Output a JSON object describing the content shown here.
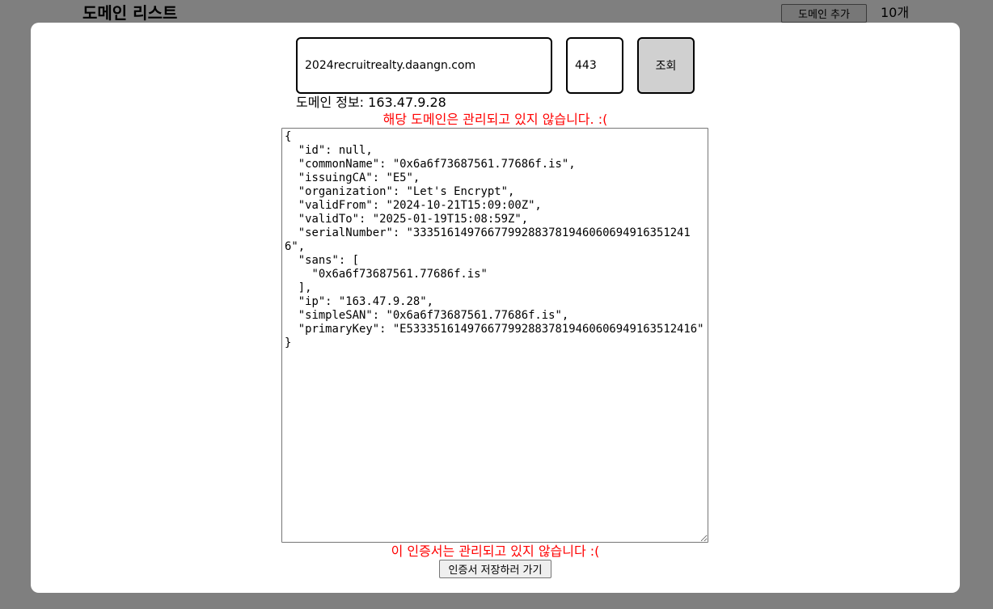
{
  "page": {
    "title": "도메인 리스트",
    "add_button_label": "도메인 추가",
    "count_label": "10개"
  },
  "modal": {
    "domain_value": "2024recruitrealty.daangn.com",
    "port_value": "443",
    "lookup_label": "조회",
    "domain_info": "도메인 정보: 163.47.9.28",
    "domain_warning": "해당 도메인은 관리되고 있지 않습니다. :(",
    "cert_json": "{\n  \"id\": null,\n  \"commonName\": \"0x6a6f73687561.77686f.is\",\n  \"issuingCA\": \"E5\",\n  \"organization\": \"Let's Encrypt\",\n  \"validFrom\": \"2024-10-21T15:09:00Z\",\n  \"validTo\": \"2025-01-19T15:08:59Z\",\n  \"serialNumber\": \"333516149766779928837819460606949163512416\",\n  \"sans\": [\n    \"0x6a6f73687561.77686f.is\"\n  ],\n  \"ip\": \"163.47.9.28\",\n  \"simpleSAN\": \"0x6a6f73687561.77686f.is\",\n  \"primaryKey\": \"E5333516149766779928837819460606949163512416\"\n}",
    "cert_warning": "이 인증서는 관리되고 있지 않습니다 :(",
    "save_button_label": "인증서 저장하러 가기"
  },
  "colors": {
    "warning": "#ff0000",
    "overlay": "rgba(0,0,0,0.5)",
    "lookup_button_bg": "#d0d0d0"
  }
}
